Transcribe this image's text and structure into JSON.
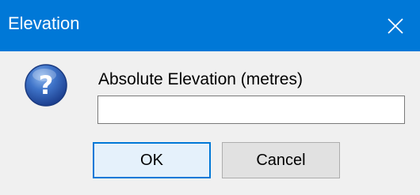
{
  "window": {
    "title": "Elevation",
    "accent_color": "#0078d7",
    "close_icon": "close-icon"
  },
  "dialog": {
    "icon": "question-icon",
    "prompt": "Absolute Elevation (metres)",
    "input_value": ""
  },
  "buttons": {
    "ok_label": "OK",
    "cancel_label": "Cancel"
  }
}
